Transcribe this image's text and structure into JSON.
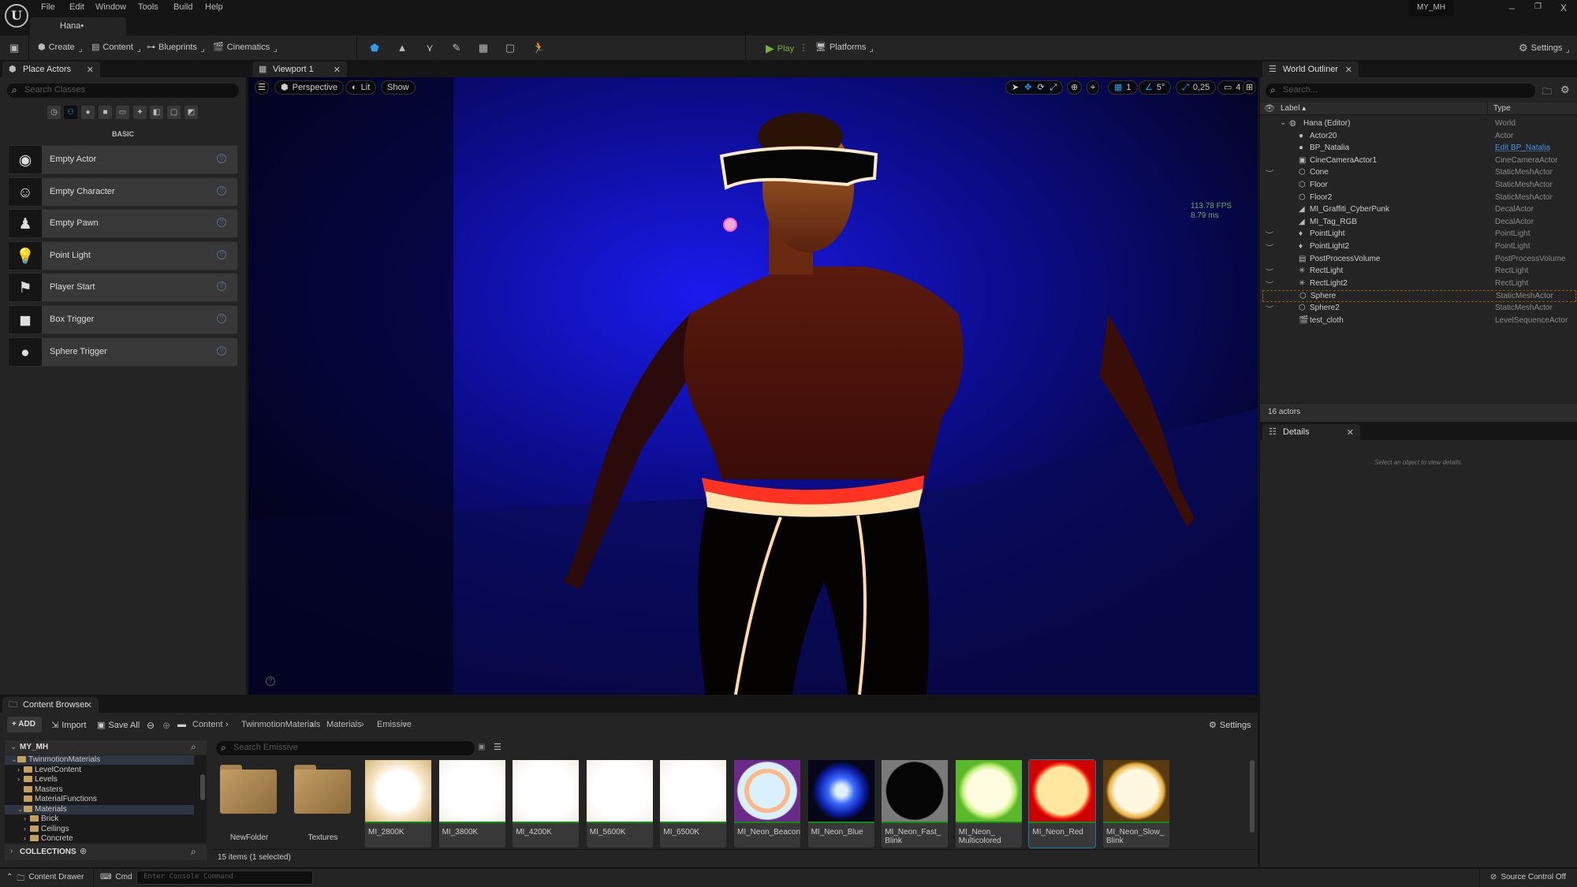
{
  "app": {
    "logo": "U",
    "menu": [
      "File",
      "Edit",
      "Window",
      "Tools",
      "Build",
      "Help"
    ],
    "document_tab": "Hana•",
    "project_name": "MY_MH",
    "window_controls": {
      "minimize": "–",
      "maximize": "❐",
      "close": "X"
    }
  },
  "toolbar": {
    "save_icon": "save-icon",
    "create": "Create",
    "content": "Content",
    "blueprints": "Blueprints",
    "cinematics": "Cinematics",
    "modes": [
      "select-mode",
      "landscape-mode",
      "foliage-mode",
      "mesh-paint-mode",
      "fracture-mode",
      "brush-edit-mode",
      "animation-mode"
    ],
    "play": "Play",
    "platforms": "Platforms",
    "settings": "Settings",
    "accent_play": "#6fb33a",
    "accent_mode": "#2e9be8"
  },
  "place_actors": {
    "tab_title": "Place Actors",
    "search_placeholder": "Search Classes",
    "filters": [
      "recent",
      "basic",
      "lights",
      "shapes",
      "cinematic",
      "visual-effects",
      "volumes",
      "all-classes",
      "geometry"
    ],
    "active_filter": "basic",
    "category": "BASIC",
    "items": [
      {
        "label": "Empty Actor",
        "icon": "◉"
      },
      {
        "label": "Empty Character",
        "icon": "☺"
      },
      {
        "label": "Empty Pawn",
        "icon": "♟"
      },
      {
        "label": "Point Light",
        "icon": "💡"
      },
      {
        "label": "Player Start",
        "icon": "⚑"
      },
      {
        "label": "Box Trigger",
        "icon": "◼"
      },
      {
        "label": "Sphere Trigger",
        "icon": "●"
      }
    ],
    "help_glyph": "?"
  },
  "viewport": {
    "tab_title": "Viewport 1",
    "hamburger": "☰",
    "perspective": "Perspective",
    "lit": "Lit",
    "show": "Show",
    "grid_snap": "1",
    "rotation_snap": "5°",
    "scale_snap": "0,25",
    "camera_speed": "4",
    "fps": "113.78 FPS",
    "frame_ms": "8.79 ms"
  },
  "outliner": {
    "tab_title": "World Outliner",
    "search_placeholder": "Search...",
    "col_label": "Label ▴",
    "col_type": "Type",
    "rows": [
      {
        "label": "Hana (Editor)",
        "type": "World",
        "icon": "◍",
        "eye": "",
        "indent": 0,
        "expand": "⌄"
      },
      {
        "label": "Actor20",
        "type": "Actor",
        "icon": "●",
        "eye": ""
      },
      {
        "label": "BP_Natalia",
        "type": "Edit BP_Natalia",
        "icon": "●",
        "eye": "",
        "link": true
      },
      {
        "label": "CineCameraActor1",
        "type": "CineCameraActor",
        "icon": "▣",
        "eye": ""
      },
      {
        "label": "Cone",
        "type": "StaticMeshActor",
        "icon": "⬡",
        "eye": "︶"
      },
      {
        "label": "Floor",
        "type": "StaticMeshActor",
        "icon": "⬡",
        "eye": ""
      },
      {
        "label": "Floor2",
        "type": "StaticMeshActor",
        "icon": "⬡",
        "eye": ""
      },
      {
        "label": "MI_Graffiti_CyberPunk",
        "type": "DecalActor",
        "icon": "◢",
        "eye": ""
      },
      {
        "label": "MI_Tag_RGB",
        "type": "DecalActor",
        "icon": "◢",
        "eye": ""
      },
      {
        "label": "PointLight",
        "type": "PointLight",
        "icon": "♦",
        "eye": "︶"
      },
      {
        "label": "PointLight2",
        "type": "PointLight",
        "icon": "♦",
        "eye": "︶"
      },
      {
        "label": "PostProcessVolume",
        "type": "PostProcessVolume",
        "icon": "▤",
        "eye": ""
      },
      {
        "label": "RectLight",
        "type": "RectLight",
        "icon": "✳",
        "eye": "︶"
      },
      {
        "label": "RectLight2",
        "type": "RectLight",
        "icon": "✳",
        "eye": "︶"
      },
      {
        "label": "Sphere",
        "type": "StaticMeshActor",
        "icon": "⬡",
        "eye": "",
        "selected": true
      },
      {
        "label": "Sphere2",
        "type": "StaticMeshActor",
        "icon": "⬡",
        "eye": "︶"
      },
      {
        "label": "test_cloth",
        "type": "LevelSequenceActor",
        "icon": "🎬",
        "eye": ""
      }
    ],
    "count": "16 actors"
  },
  "details": {
    "tab_title": "Details",
    "empty_message": "Select an object to view details."
  },
  "content_browser": {
    "tab_title": "Content Browser",
    "add": "ADD",
    "import": "Import",
    "save_all": "Save All",
    "breadcrumb": [
      "Content",
      "TwinmotionMaterials",
      "Materials",
      "Emissive"
    ],
    "settings": "Settings",
    "root": "MY_MH",
    "tree": [
      {
        "label": "TwinmotionMaterials",
        "level": 0,
        "arrow": "⌄",
        "open": true,
        "highlight": true
      },
      {
        "label": "LevelContent",
        "level": 1,
        "arrow": "›"
      },
      {
        "label": "Levels",
        "level": 1,
        "arrow": "›"
      },
      {
        "label": "Masters",
        "level": 1,
        "arrow": ""
      },
      {
        "label": "MaterialFunctions",
        "level": 1,
        "arrow": ""
      },
      {
        "label": "Materials",
        "level": 1,
        "arrow": "⌄",
        "open": true,
        "highlight": true
      },
      {
        "label": "Brick",
        "level": 2,
        "arrow": "›"
      },
      {
        "label": "Ceilings",
        "level": 2,
        "arrow": "›"
      },
      {
        "label": "Concrete",
        "level": 2,
        "arrow": "›"
      }
    ],
    "collections": "COLLECTIONS",
    "search_placeholder": "Search Emissive",
    "folders": [
      "NewFolder",
      "Textures"
    ],
    "assets": [
      {
        "name": "MI_2800K",
        "style": "warm-white"
      },
      {
        "name": "MI_3800K",
        "style": "white"
      },
      {
        "name": "MI_4200K",
        "style": "white"
      },
      {
        "name": "MI_5600K",
        "style": "white"
      },
      {
        "name": "MI_6500K",
        "style": "white"
      },
      {
        "name": "MI_Neon_Beacon",
        "style": "beacon"
      },
      {
        "name": "MI_Neon_Blue",
        "style": "blue"
      },
      {
        "name": "MI_Neon_Fast_\nBlink",
        "style": "black"
      },
      {
        "name": "MI_Neon_\nMulticolored",
        "style": "green"
      },
      {
        "name": "MI_Neon_Red",
        "style": "red",
        "selected": true
      },
      {
        "name": "MI_Neon_Slow_\nBlink",
        "style": "gold"
      }
    ],
    "status": "15 items (1 selected)"
  },
  "statusbar": {
    "content_drawer": "Content Drawer",
    "cmd": "Cmd",
    "console_placeholder": "Enter Console Command",
    "source_control": "Source Control Off"
  }
}
